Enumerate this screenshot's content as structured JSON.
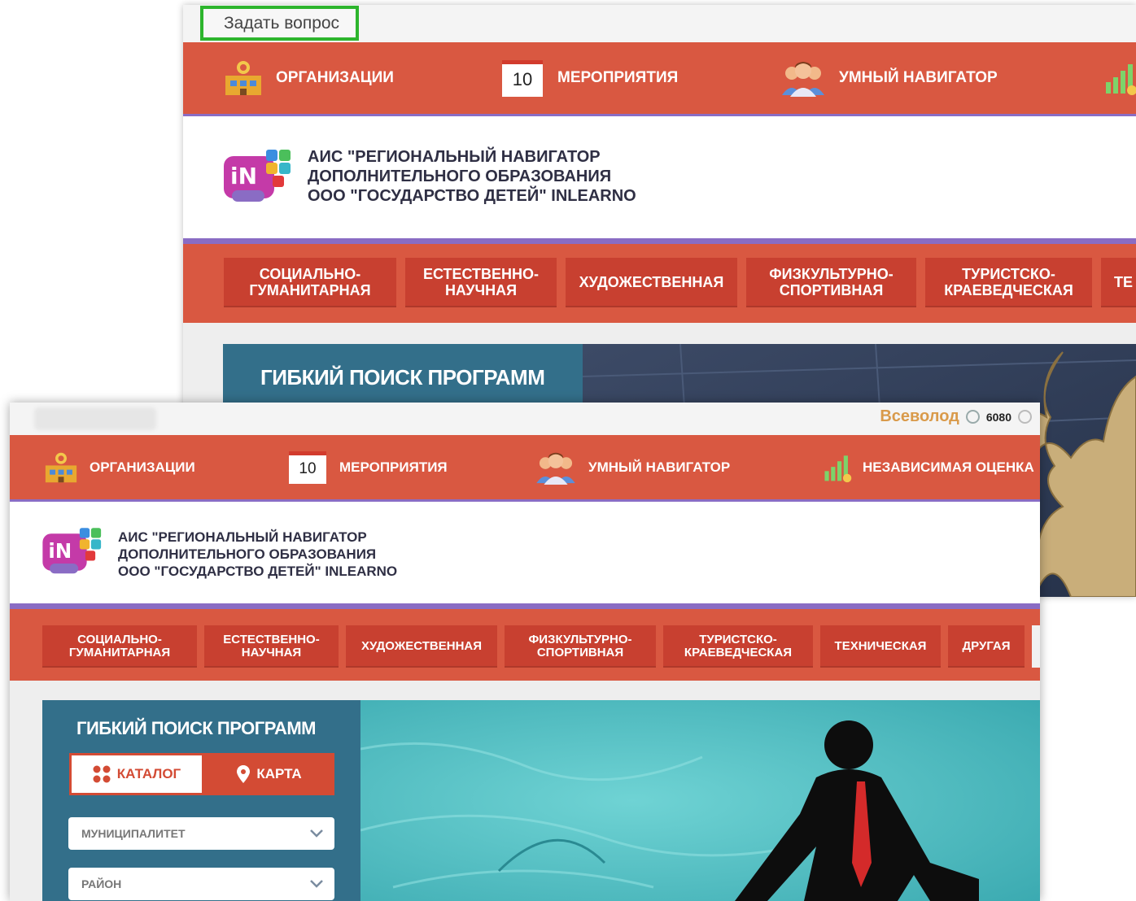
{
  "ask_question": "Задать вопрос",
  "nav": {
    "organizations": "ОРГАНИЗАЦИИ",
    "events": "МЕРОПРИЯТИЯ",
    "events_count": "10",
    "smart_navigator": "УМНЫЙ НАВИГАТОР",
    "independent_assessment": "НЕЗАВИСИМАЯ ОЦЕНКА"
  },
  "header": {
    "line1": "АИС \"РЕГИОНАЛЬНЫЙ НАВИГАТОР",
    "line2": "ДОПОЛНИТЕЛЬНОГО ОБРАЗОВАНИЯ",
    "line3": "ООО \"ГОСУДАРСТВО ДЕТЕЙ\" INLEARNO"
  },
  "categories": {
    "social": "СОЦИАЛЬНО-\nГУМАНИТАРНАЯ",
    "science": "ЕСТЕСТВЕННО-\nНАУЧНАЯ",
    "art": "ХУДОЖЕСТВЕННАЯ",
    "sport": "ФИЗКУЛЬТУРНО-\nСПОРТИВНАЯ",
    "tourism": "ТУРИСТСКО-\nКРАЕВЕДЧЕСКАЯ",
    "technical": "ТЕХНИЧЕСКАЯ",
    "technical_cut": "ТЕ",
    "other": "ДРУГАЯ"
  },
  "user": {
    "name": "Всеволод",
    "score": "6080"
  },
  "search": {
    "title": "ГИБКИЙ ПОИСК ПРОГРАММ",
    "catalog": "КАТАЛОГ",
    "map": "КАРТА",
    "municipality": "МУНИЦИПАЛИТЕТ",
    "district": "РАЙОН"
  },
  "colors": {
    "nav_bg": "#d95841",
    "category_bg": "#c84030",
    "accent_purple": "#8a6cc4",
    "search_panel": "#336f8a",
    "highlight": "#2db52d"
  }
}
